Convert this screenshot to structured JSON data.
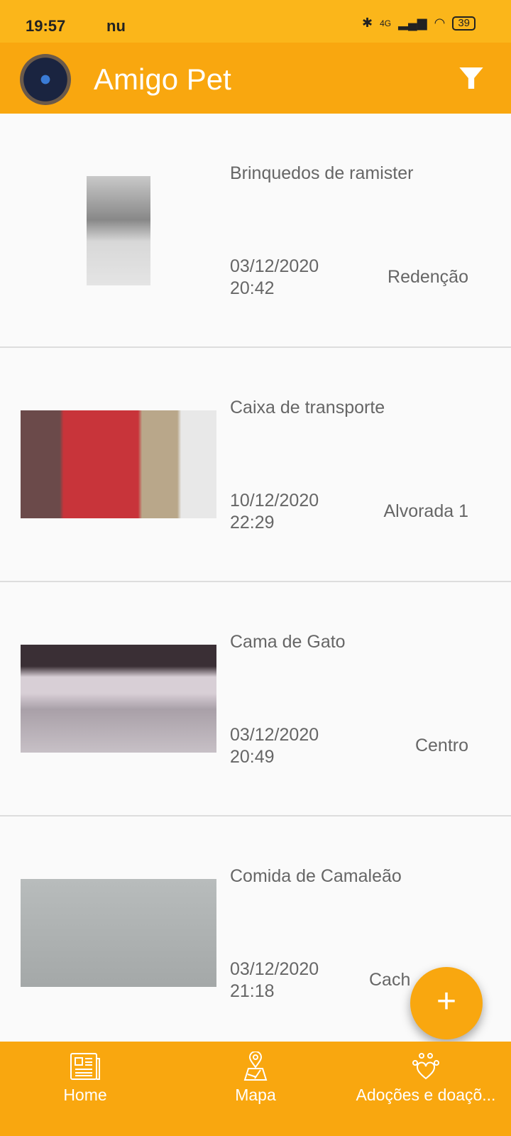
{
  "status": {
    "time": "19:57",
    "carrier": "nu",
    "network": "4G",
    "battery": "39"
  },
  "appbar": {
    "title": "Amigo Pet",
    "filter_icon": "filter-icon"
  },
  "items": [
    {
      "name": "Brinquedos de ramister",
      "date": "03/12/2020",
      "time": "20:42",
      "location": "Redenção"
    },
    {
      "name": "Caixa de transporte",
      "date": "10/12/2020",
      "time": "22:29",
      "location": "Alvorada 1"
    },
    {
      "name": "Cama de Gato",
      "date": "03/12/2020",
      "time": "20:49",
      "location": "Centro"
    },
    {
      "name": "Comida de Camaleão",
      "date": "03/12/2020",
      "time": "21:18",
      "location": "Cach"
    }
  ],
  "fab": {
    "label": "+"
  },
  "nav": [
    {
      "label": "Home",
      "icon": "newspaper-icon"
    },
    {
      "label": "Mapa",
      "icon": "map-pin-icon"
    },
    {
      "label": "Adoções e doaçõ...",
      "icon": "paw-heart-icon"
    }
  ],
  "colors": {
    "primary": "#f9a70f",
    "status": "#fbb61a"
  }
}
